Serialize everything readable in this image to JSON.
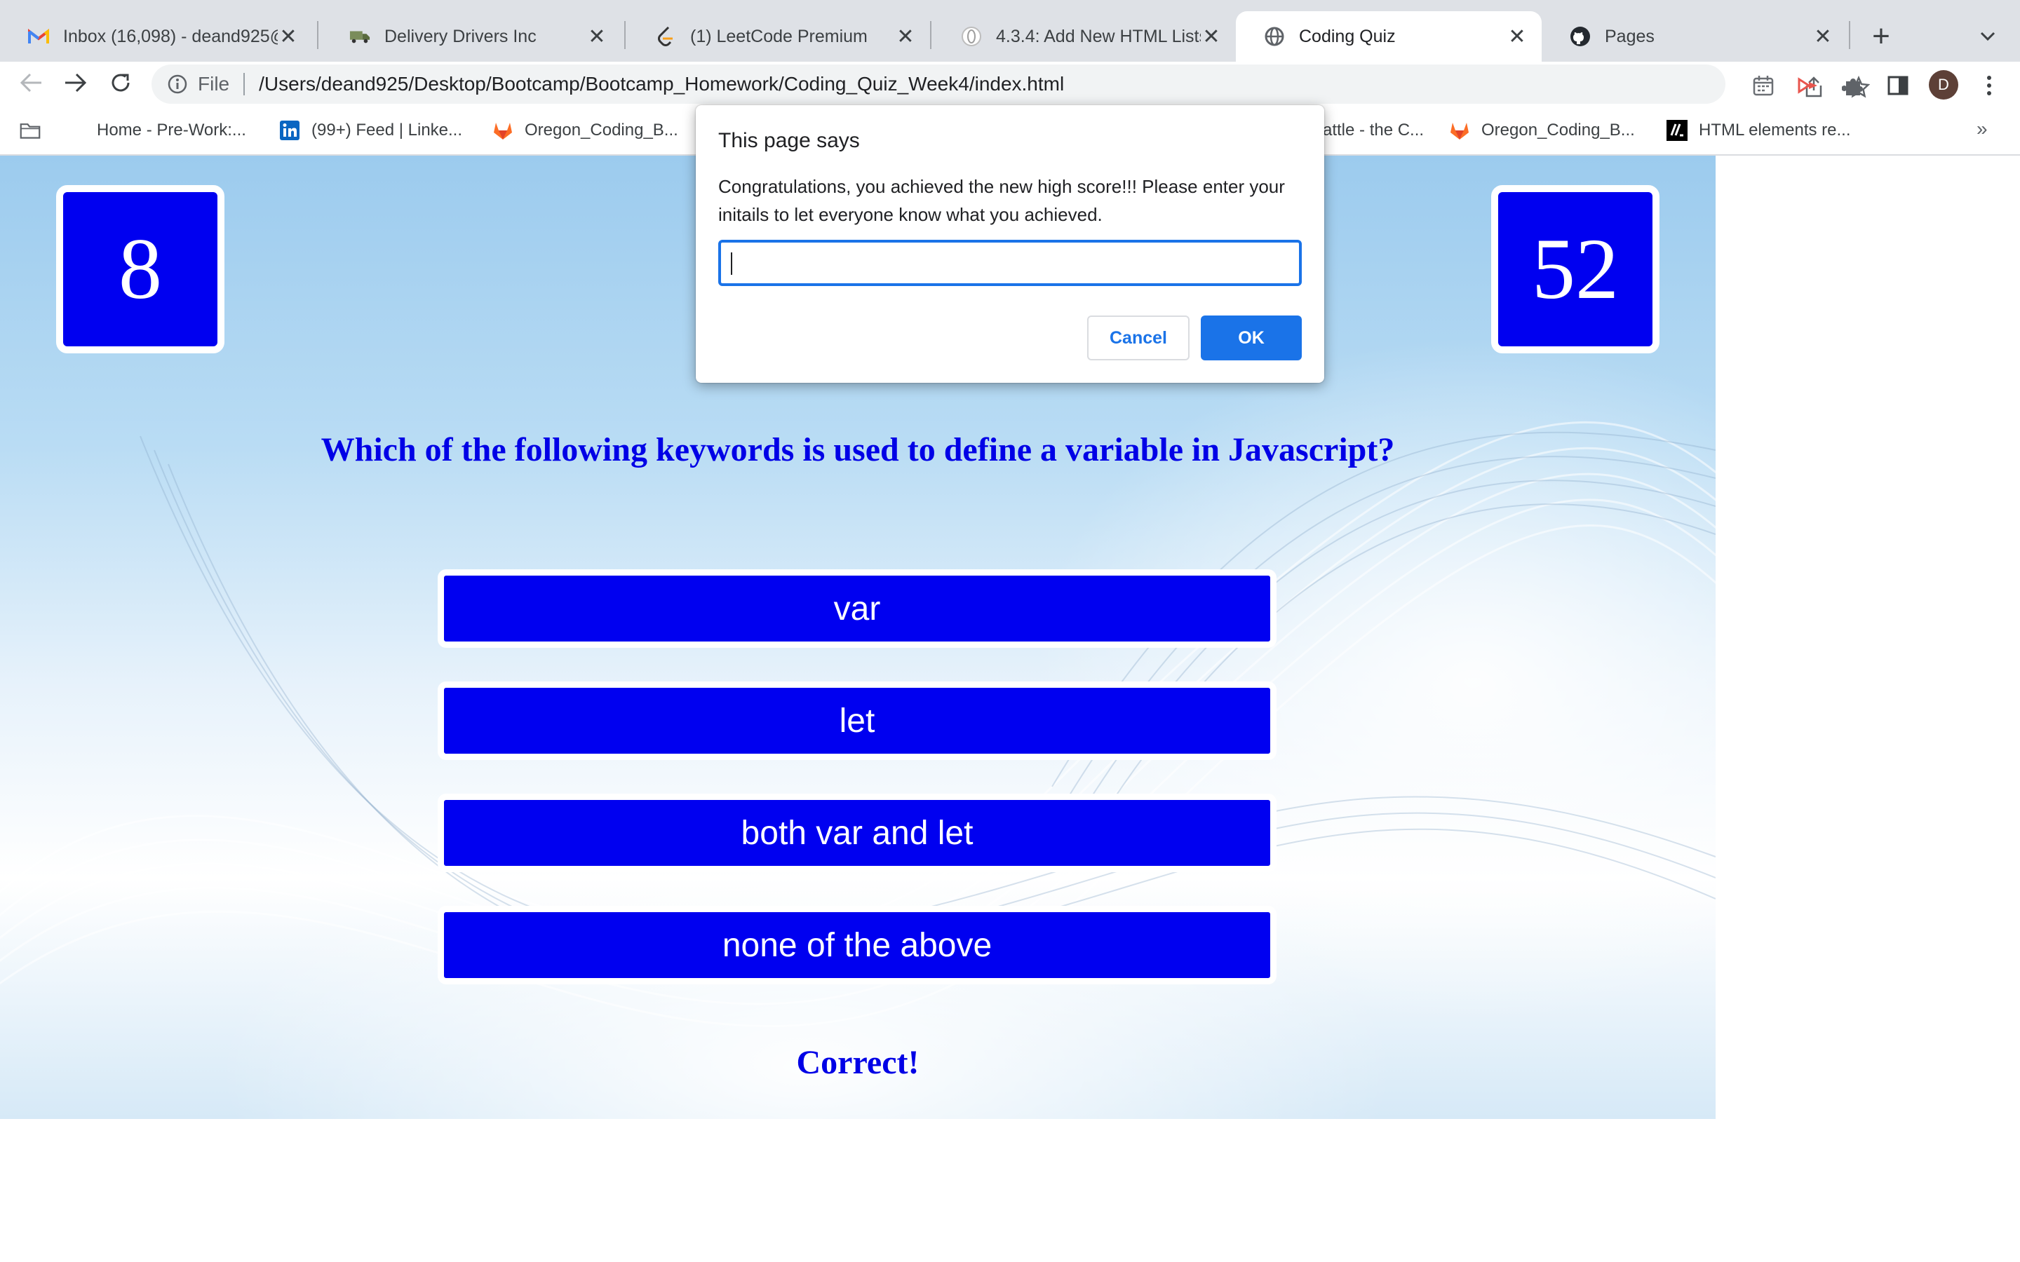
{
  "browser": {
    "tabs": [
      {
        "title": "Inbox (16,098) - deand925@",
        "icon": "gmail-icon"
      },
      {
        "title": "Delivery Drivers Inc",
        "icon": "truck-icon"
      },
      {
        "title": "(1) LeetCode Premium",
        "icon": "leetcode-icon"
      },
      {
        "title": "4.3.4: Add New HTML Lists",
        "icon": "circle-icon"
      },
      {
        "title": "Coding Quiz",
        "icon": "globe-icon"
      },
      {
        "title": "Pages",
        "icon": "github-icon"
      }
    ],
    "active_tab": 4,
    "tab_close_glyph": "✕",
    "new_tab_glyph": "+",
    "address": {
      "scheme": "File",
      "url": "/Users/deand925/Desktop/Bootcamp/Bootcamp_Homework/Coding_Quiz_Week4/index.html"
    },
    "profile_initial": "D",
    "bookmarks": [
      {
        "label": "",
        "icon": "folder-icon"
      },
      {
        "label": "Home - Pre-Work:...",
        "icon": "blank-icon"
      },
      {
        "label": "(99+) Feed | Linke...",
        "icon": "linkedin-icon"
      },
      {
        "label": "Oregon_Coding_B...",
        "icon": "gitlab-icon"
      },
      {
        "label": "attle - the C...",
        "icon": "blank-icon"
      },
      {
        "label": "Oregon_Coding_B...",
        "icon": "gitlab-icon"
      },
      {
        "label": "HTML elements re...",
        "icon": "mdn-icon"
      }
    ],
    "bookmarks_more": "»"
  },
  "quiz": {
    "timer": "8",
    "score": "52",
    "question": "Which of the following keywords is used to define a variable in Javascript?",
    "answers": [
      "var",
      "let",
      "both var and let",
      "none of the above"
    ],
    "feedback": "Correct!"
  },
  "dialog": {
    "title": "This page says",
    "message": "Congratulations, you achieved the new high score!!! Please enter your initails to let everyone know what you achieved.",
    "input_value": "",
    "cancel_label": "Cancel",
    "ok_label": "OK"
  },
  "colors": {
    "quiz_blue": "#0000f0",
    "dialog_accent": "#1a73e8",
    "tabstrip_bg": "#dee1e6"
  }
}
